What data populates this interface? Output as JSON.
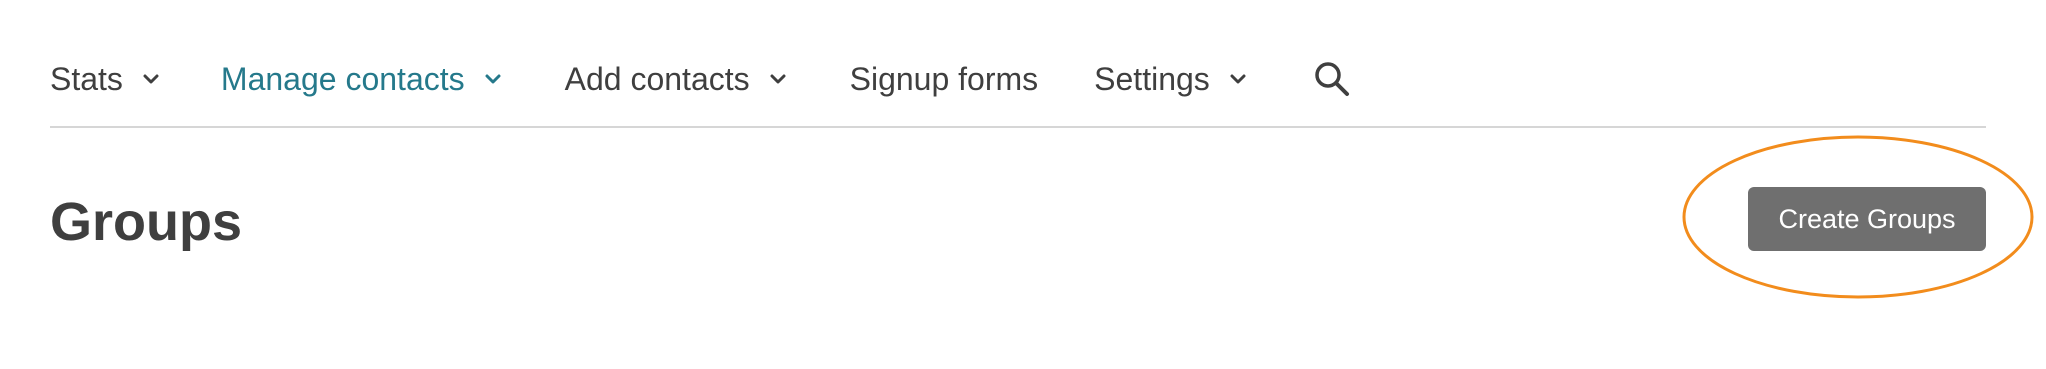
{
  "nav": {
    "items": [
      {
        "label": "Stats",
        "has_dropdown": true,
        "active": false
      },
      {
        "label": "Manage contacts",
        "has_dropdown": true,
        "active": true
      },
      {
        "label": "Add contacts",
        "has_dropdown": true,
        "active": false
      },
      {
        "label": "Signup forms",
        "has_dropdown": false,
        "active": false
      },
      {
        "label": "Settings",
        "has_dropdown": true,
        "active": false
      }
    ],
    "search_icon": "search-icon",
    "dropdown_icon": "chevron-down-icon"
  },
  "page": {
    "title": "Groups",
    "create_button_label": "Create Groups"
  },
  "colors": {
    "text": "#3f3f3f",
    "active_nav": "#25798b",
    "button_bg": "#6f6f6f",
    "button_text": "#ffffff",
    "divider": "#d6d6d6",
    "highlight_ring": "#f28c1c"
  }
}
